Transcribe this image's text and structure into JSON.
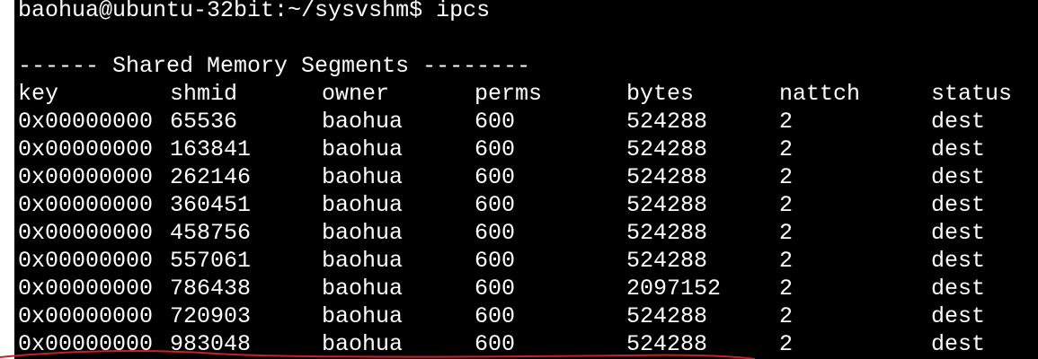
{
  "prompt": {
    "text": "baohua@ubuntu-32bit:~/sysvshm$ ipcs"
  },
  "section_header": "------ Shared Memory Segments --------",
  "columns": [
    "key",
    "shmid",
    "owner",
    "perms",
    "bytes",
    "nattch",
    "status"
  ],
  "rows": [
    [
      "0x00000000",
      "65536",
      "baohua",
      "600",
      "524288",
      "2",
      "dest"
    ],
    [
      "0x00000000",
      "163841",
      "baohua",
      "600",
      "524288",
      "2",
      "dest"
    ],
    [
      "0x00000000",
      "262146",
      "baohua",
      "600",
      "524288",
      "2",
      "dest"
    ],
    [
      "0x00000000",
      "360451",
      "baohua",
      "600",
      "524288",
      "2",
      "dest"
    ],
    [
      "0x00000000",
      "458756",
      "baohua",
      "600",
      "524288",
      "2",
      "dest"
    ],
    [
      "0x00000000",
      "557061",
      "baohua",
      "600",
      "524288",
      "2",
      "dest"
    ],
    [
      "0x00000000",
      "786438",
      "baohua",
      "600",
      "2097152",
      "2",
      "dest"
    ],
    [
      "0x00000000",
      "720903",
      "baohua",
      "600",
      "524288",
      "2",
      "dest"
    ],
    [
      "0x00000000",
      "983048",
      "baohua",
      "600",
      "524288",
      "2",
      "dest"
    ]
  ],
  "colors": {
    "terminal_bg": "#000000",
    "terminal_fg": "#ffffff",
    "annotation_stroke": "#c8202a"
  }
}
